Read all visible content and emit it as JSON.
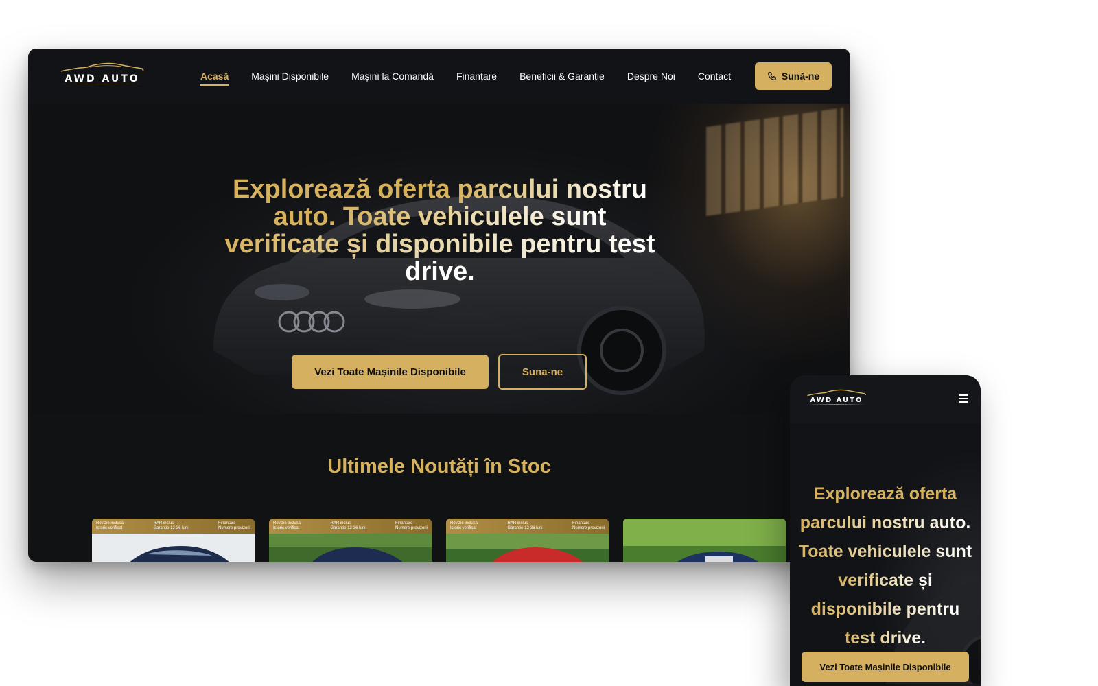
{
  "brand": {
    "logo_text": "AWD AUTO",
    "accent_color": "#d4b060"
  },
  "nav": {
    "items": [
      {
        "label": "Acasă",
        "active": true
      },
      {
        "label": "Mașini Disponibile"
      },
      {
        "label": "Mașini la Comandă"
      },
      {
        "label": "Finanțare"
      },
      {
        "label": "Beneficii & Garanție"
      },
      {
        "label": "Despre Noi"
      },
      {
        "label": "Contact"
      }
    ],
    "call_label": "Sună-ne"
  },
  "hero": {
    "line1_gold": "Explorează oferta",
    "line1_grad": "parcului nostru",
    "line2_gold": "auto.",
    "line2_grad": "Toate vehiculele sunt",
    "line3_grad": "verificate și disponibile pentru test",
    "line4": "drive.",
    "primary_button": "Vezi Toate Mașinile Disponibile",
    "secondary_button": "Suna-ne"
  },
  "news": {
    "title": "Ultimele Noutăți în Stoc",
    "badges": {
      "revizie": "Revizie inclusă",
      "istoric": "Istoric verificat",
      "rar": "RAR inclus",
      "garantie": "Garantie 12-36 luni",
      "finantare": "Finantare",
      "numere": "Numere provizorii"
    }
  },
  "mobile": {
    "line1": "Explorează oferta",
    "line2": "parcului nostru auto.",
    "line3": "Toate vehiculele sunt",
    "line4": "verificate și",
    "line5": "disponibile pentru",
    "line6": "test drive.",
    "button": "Vezi Toate Mașinile Disponibile"
  }
}
